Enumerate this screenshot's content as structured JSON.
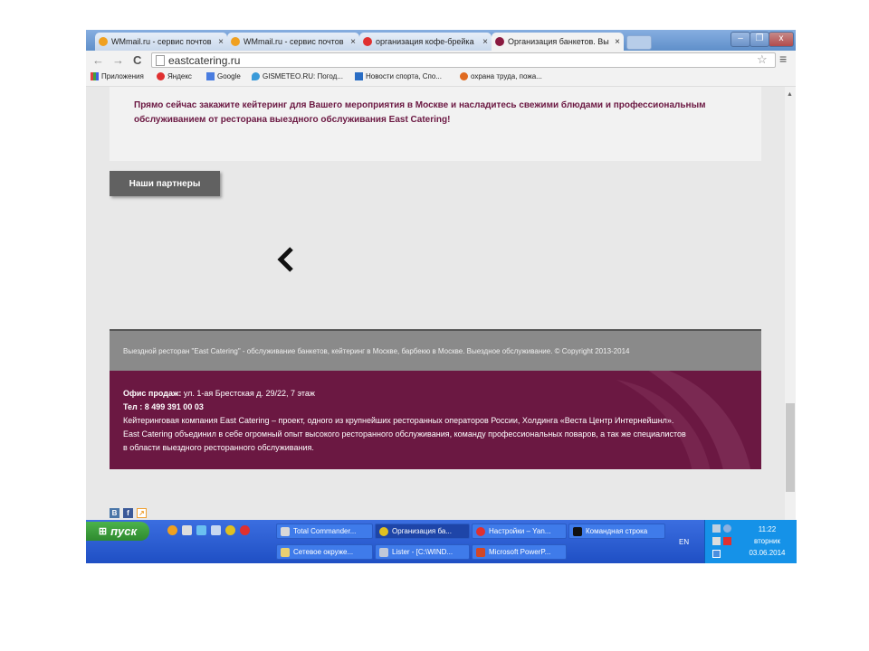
{
  "browser": {
    "tabs": [
      {
        "label": "WMmail.ru - сервис почтов",
        "icon": "wmmail-icon",
        "color": "#f0a020",
        "active": false
      },
      {
        "label": "WMmail.ru - сервис почтов",
        "icon": "wmmail-icon",
        "color": "#f0a020",
        "active": false
      },
      {
        "label": "организация кофе-брейка",
        "icon": "yandex-icon",
        "color": "#e03030",
        "active": false
      },
      {
        "label": "Организация банкетов. Вы",
        "icon": "eastcatering-icon",
        "color": "#8a1a40",
        "active": true
      }
    ],
    "close_glyph": "×",
    "window_controls": {
      "minimize": "–",
      "restore": "❐",
      "close": "x"
    },
    "nav": {
      "back": "←",
      "forward": "→",
      "reload": "C"
    },
    "address": "eastcatering.ru",
    "star_glyph": "☆",
    "menu_glyph": "≡",
    "bookmarks": [
      {
        "label": "Приложения",
        "icon": "apps-icon"
      },
      {
        "label": "Яндекс",
        "icon": "yandex-icon"
      },
      {
        "label": "Google",
        "icon": "google-icon"
      },
      {
        "label": "GISMETEO.RU: Погод...",
        "icon": "gismeteo-icon"
      },
      {
        "label": "Новости спорта, Спо...",
        "icon": "sports-icon"
      },
      {
        "label": "охрана труда, пожа...",
        "icon": "safety-icon"
      }
    ]
  },
  "page": {
    "promo_text": "Прямо сейчас закажите кейтеринг для Вашего мероприятия в Москве и насладитесь свежими блюдами и профессиональным обслуживанием от ресторана выездного обслуживания East Catering!",
    "partners_button": "Наши партнеры",
    "carousel_prev": "‹",
    "footer_copyright": "Выездной ресторан \"East Catering\" - обслуживание банкетов, кейтеринг в Москве, барбекю в Москве. Выездное обслуживание. © Copyright 2013-2014",
    "office_label": "Офис продаж:",
    "office_address": " ул. 1-ая Брестская д. 29/22, 7 этаж",
    "phone": "Тел : 8 499 391 00 03",
    "about_lines": [
      "Кейтеринговая компания East Catering – проект, одного из крупнейших ресторанных операторов России, Холдинга «Веста Центр Интернейшнл».",
      "East Catering объединил в себе огромный опыт высокого ресторанного обслуживания, команду профессиональных поваров, а так же специалистов",
      "в области выездного ресторанного обслуживания."
    ],
    "social": [
      {
        "label": "В",
        "icon": "vk-icon",
        "color": "#4a76a8"
      },
      {
        "label": "f",
        "icon": "facebook-icon",
        "color": "#3b5998"
      },
      {
        "label": "↗",
        "icon": "share-icon",
        "color": "#f0a030"
      }
    ],
    "colors": {
      "accent": "#6b1842",
      "footer_gray": "#8a8a8a",
      "button": "#616161"
    }
  },
  "taskbar": {
    "start_label": "пуск",
    "buttons_row1": [
      {
        "label": "Total Commander...",
        "icon": "totalcmd-icon",
        "active": false
      },
      {
        "label": "Организация ба...",
        "icon": "chrome-icon",
        "active": true
      },
      {
        "label": "Настройки – Yan...",
        "icon": "yandex-browser-icon",
        "active": false
      },
      {
        "label": "Командная строка",
        "icon": "cmd-icon",
        "active": false
      }
    ],
    "buttons_row2": [
      {
        "label": "Сетевое окруже...",
        "icon": "network-icon",
        "active": false
      },
      {
        "label": "Lister - [C:\\WIND...",
        "icon": "lister-icon",
        "active": false
      },
      {
        "label": "Microsoft PowerP...",
        "icon": "powerpoint-icon",
        "active": false
      }
    ],
    "language": "EN",
    "time": "11:22",
    "weekday": "вторник",
    "date": "03.06.2014"
  }
}
